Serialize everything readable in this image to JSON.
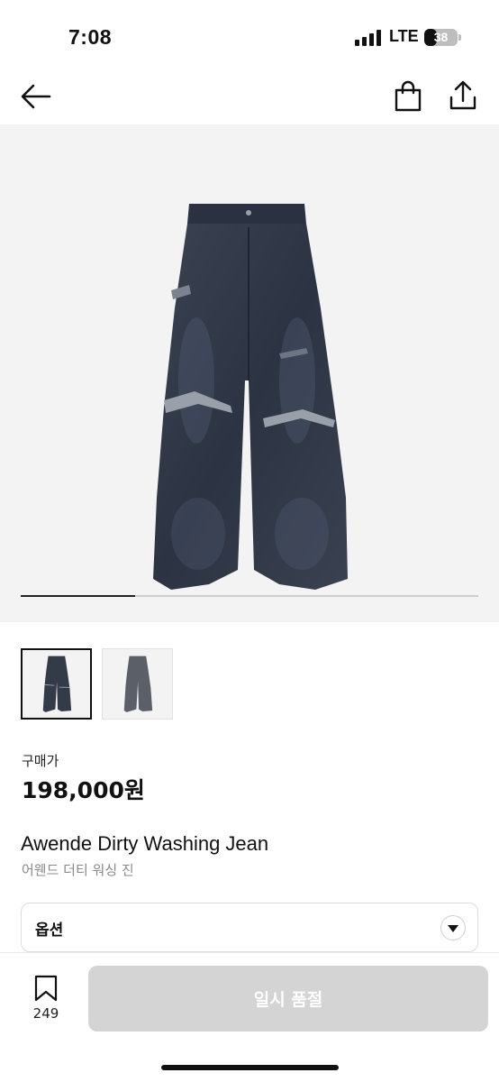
{
  "status_bar": {
    "time": "7:08",
    "network": "LTE",
    "battery_level": "38",
    "battery_fraction": 0.38
  },
  "nav": {
    "back_icon": "arrow-left-icon",
    "bag_icon": "shopping-bag-icon",
    "share_icon": "share-icon"
  },
  "gallery": {
    "image_count": 2,
    "current_index": 1,
    "progress_fraction": 0.25,
    "thumbnails": [
      {
        "selected": true
      },
      {
        "selected": false
      }
    ]
  },
  "product": {
    "price_label": "구매가",
    "price": "198,000원",
    "name": "Awende Dirty Washing Jean",
    "name_kr": "어웬드 더티 워싱 진"
  },
  "options": {
    "label": "옵션",
    "toggle_icon": "caret-down-icon"
  },
  "bottom_bar": {
    "bookmark_icon": "bookmark-icon",
    "bookmark_count": "249",
    "action_label": "일시 품절",
    "action_color": "#d4d4d4"
  }
}
